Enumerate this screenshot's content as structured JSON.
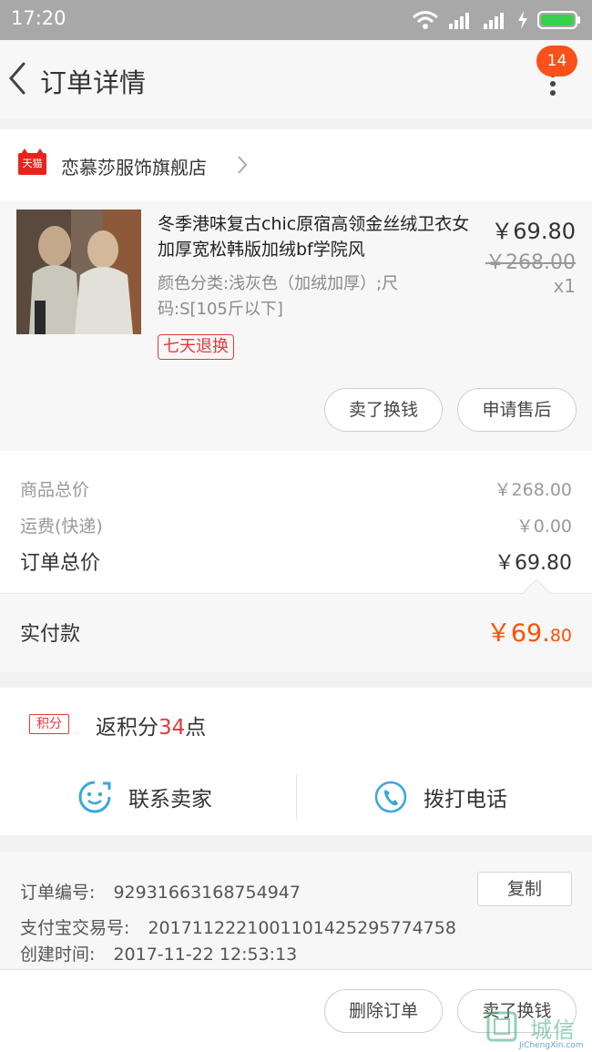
{
  "status_bar": {
    "time": "17:20"
  },
  "nav": {
    "title": "订单详情",
    "badge_count": "14"
  },
  "shop": {
    "logo_text": "天猫",
    "name": "恋慕莎服饰旗舰店"
  },
  "product": {
    "name": "冬季港味复古chic原宿高领金丝绒卫衣女加厚宽松韩版加绒bf学院风",
    "spec": "颜色分类:浅灰色（加绒加厚）;尺码:S[105斤以下]",
    "price": "￥69.80",
    "original_price": "￥268.00",
    "quantity": "x1",
    "return_tag": "七天退换",
    "buttons": {
      "sell": "卖了换钱",
      "after_sales": "申请售后"
    }
  },
  "totals": {
    "goods_label": "商品总价",
    "goods_value": "￥268.00",
    "shipping_label": "运费(快递)",
    "shipping_value": "￥0.00",
    "order_label": "订单总价",
    "order_value": "￥69.80",
    "paid_label": "实付款",
    "paid_value_main": "￥69.",
    "paid_value_cents": "80"
  },
  "points": {
    "tag": "积分",
    "text_prefix": "返积分",
    "value": "34",
    "text_suffix": "点"
  },
  "contact": {
    "seller": "联系卖家",
    "call": "拨打电话"
  },
  "order_info": {
    "number_label": "订单编号:",
    "number_value": "92931663168754947",
    "copy_label": "复制",
    "alipay_label": "支付宝交易号:",
    "alipay_value": "2017112221001101425295774758",
    "created_label": "创建时间:",
    "created_value": "2017-11-22 12:53:13"
  },
  "bottom_actions": {
    "delete": "删除订单",
    "sell": "卖了换钱"
  },
  "watermark": {
    "text": "城信",
    "sub": "JiChengXin.com"
  },
  "colors": {
    "accent": "#ff5000",
    "badge": "#f8511a",
    "tmall_red": "#e8231e",
    "contact_blue": "#3aa6e0"
  }
}
